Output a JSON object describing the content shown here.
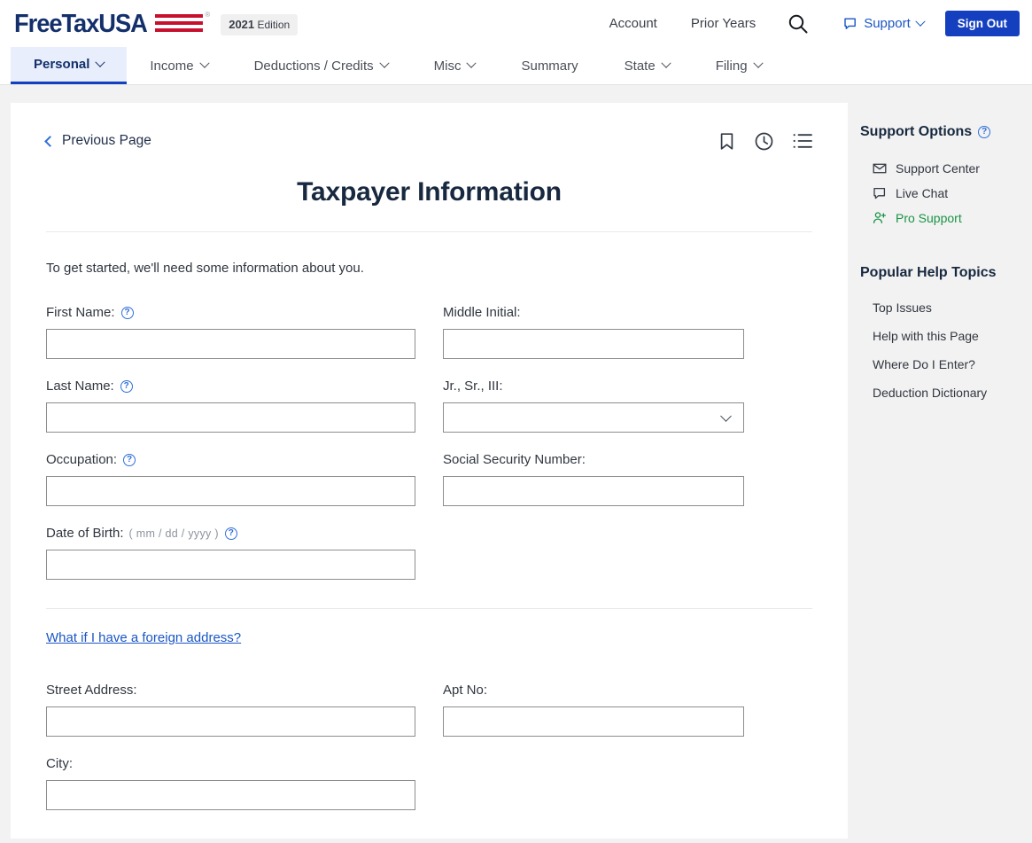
{
  "header": {
    "logo_text": "FreeTaxUSA",
    "logo_registered": "®",
    "edition_year": "2021",
    "edition_label": "Edition",
    "nav_links": [
      {
        "label": "Account",
        "name": "account"
      },
      {
        "label": "Prior Years",
        "name": "prior-years"
      }
    ],
    "search_icon": "search-icon",
    "support_label": "Support",
    "support_icon": "chat-bubble-icon",
    "signout_label": "Sign Out",
    "accent_blue": "#1440c0",
    "link_blue": "#1a56c4"
  },
  "mainnav": {
    "items": [
      {
        "label": "Personal",
        "has_chevron": true,
        "active": true,
        "name": "personal"
      },
      {
        "label": "Income",
        "has_chevron": true,
        "active": false,
        "name": "income"
      },
      {
        "label": "Deductions / Credits",
        "has_chevron": true,
        "active": false,
        "name": "deductions-credits"
      },
      {
        "label": "Misc",
        "has_chevron": true,
        "active": false,
        "name": "misc"
      },
      {
        "label": "Summary",
        "has_chevron": false,
        "active": false,
        "name": "summary"
      },
      {
        "label": "State",
        "has_chevron": true,
        "active": false,
        "name": "state"
      },
      {
        "label": "Filing",
        "has_chevron": true,
        "active": false,
        "name": "filing"
      }
    ]
  },
  "card": {
    "previous_page_label": "Previous Page",
    "icons": [
      "bookmark-icon",
      "clock-icon",
      "list-icon"
    ],
    "title": "Taxpayer Information",
    "intro": "To get started, we'll need some information about you.",
    "foreign_address_link": "What if I have a foreign address?"
  },
  "form": {
    "first_name": {
      "label": "First Name:",
      "value": "",
      "placeholder": "",
      "help": "?"
    },
    "middle_initial": {
      "label": "Middle Initial:",
      "value": "",
      "placeholder": ""
    },
    "last_name": {
      "label": "Last Name:",
      "value": "",
      "placeholder": "",
      "help": "?"
    },
    "suffix": {
      "label": "Jr., Sr., III:",
      "value": "",
      "options": [
        ""
      ]
    },
    "occupation": {
      "label": "Occupation:",
      "value": "",
      "placeholder": "",
      "help": "?"
    },
    "ssn": {
      "label": "Social Security Number:",
      "value": "",
      "placeholder": ""
    },
    "dob": {
      "label": "Date of Birth:",
      "hint": "( mm / dd / yyyy )",
      "value": "",
      "placeholder": "",
      "help": "?"
    },
    "street_address": {
      "label": "Street Address:",
      "value": "",
      "placeholder": ""
    },
    "apt_no": {
      "label": "Apt No:",
      "value": "",
      "placeholder": ""
    },
    "city": {
      "label": "City:",
      "value": "",
      "placeholder": ""
    }
  },
  "sidebar": {
    "support_options_title": "Support Options",
    "support_options_help": "?",
    "support_items": [
      {
        "label": "Support Center",
        "icon": "envelope-icon",
        "green": false
      },
      {
        "label": "Live Chat",
        "icon": "chat-bubble-icon",
        "green": false
      },
      {
        "label": "Pro Support",
        "icon": "person-plus-icon",
        "green": true
      }
    ],
    "popular_help_title": "Popular Help Topics",
    "topics": [
      {
        "label": "Top Issues"
      },
      {
        "label": "Help with this Page"
      },
      {
        "label": "Where Do I Enter?"
      },
      {
        "label": "Deduction Dictionary"
      }
    ],
    "green": "#1a9446"
  }
}
